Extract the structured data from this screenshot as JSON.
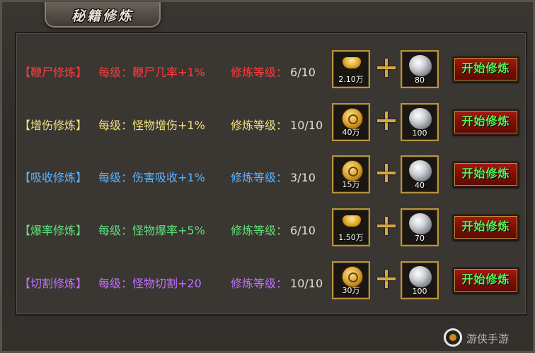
{
  "window": {
    "title": "秘籍修炼"
  },
  "rows": [
    {
      "name": "【鞭尸修炼】",
      "per_label": "每级：",
      "per_effect": "鞭尸几率+1%",
      "level_label": "修炼等级：",
      "level": "6/10",
      "cost1_type": "gold-ingot",
      "cost1": "2.10万",
      "cost2_type": "stone",
      "cost2": "80",
      "button": "开始修炼",
      "color": "#ff3c3c"
    },
    {
      "name": "【增伤修炼】",
      "per_label": "每级：",
      "per_effect": "怪物增伤+1%",
      "level_label": "修炼等级：",
      "level": "10/10",
      "cost1_type": "gold-coin",
      "cost1": "40万",
      "cost2_type": "stone",
      "cost2": "100",
      "button": "开始修炼",
      "color": "#f0e080"
    },
    {
      "name": "【吸收修炼】",
      "per_label": "每级：",
      "per_effect": "伤害吸收+1%",
      "level_label": "修炼等级：",
      "level": "3/10",
      "cost1_type": "gold-coin",
      "cost1": "15万",
      "cost2_type": "stone",
      "cost2": "40",
      "button": "开始修炼",
      "color": "#5ab4ff"
    },
    {
      "name": "【爆率修炼】",
      "per_label": "每级：",
      "per_effect": "怪物爆率+5%",
      "level_label": "修炼等级：",
      "level": "6/10",
      "cost1_type": "gold-ingot",
      "cost1": "1.50万",
      "cost2_type": "stone",
      "cost2": "70",
      "button": "开始修炼",
      "color": "#5fe07a"
    },
    {
      "name": "【切割修炼】",
      "per_label": "每级：",
      "per_effect": "怪物切割+20",
      "level_label": "修炼等级：",
      "level": "10/10",
      "cost1_type": "gold-coin",
      "cost1": "30万",
      "cost2_type": "stone",
      "cost2": "100",
      "button": "开始修炼",
      "color": "#c070ff"
    }
  ],
  "watermark": {
    "text": "游侠手游",
    "icon": "logo-icon"
  }
}
